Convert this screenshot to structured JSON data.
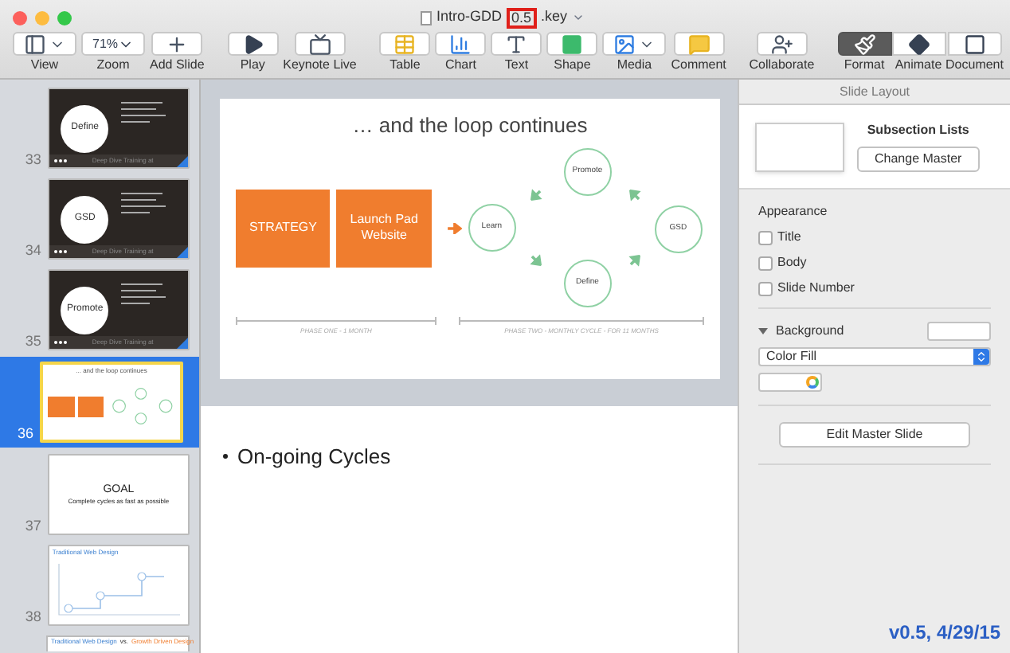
{
  "window": {
    "title": "Intro-GDD",
    "title_highlight": "0.5",
    "title_suffix": ".key"
  },
  "toolbar": [
    {
      "kind": "view",
      "label": "View"
    },
    {
      "kind": "zoom",
      "label": "Zoom",
      "value": "71%"
    },
    {
      "kind": "add",
      "label": "Add Slide"
    },
    {
      "kind": "gap"
    },
    {
      "kind": "play",
      "label": "Play"
    },
    {
      "kind": "live",
      "label": "Keynote Live"
    },
    {
      "kind": "gap"
    },
    {
      "kind": "table",
      "label": "Table"
    },
    {
      "kind": "chart",
      "label": "Chart"
    },
    {
      "kind": "text",
      "label": "Text"
    },
    {
      "kind": "shape",
      "label": "Shape"
    },
    {
      "kind": "media",
      "label": "Media"
    },
    {
      "kind": "comment",
      "label": "Comment"
    },
    {
      "kind": "gap"
    },
    {
      "kind": "collaborate",
      "label": "Collaborate"
    },
    {
      "kind": "gap"
    }
  ],
  "inspector_tabs": [
    {
      "kind": "format",
      "label": "Format",
      "selected": true
    },
    {
      "kind": "animate",
      "label": "Animate",
      "selected": false
    },
    {
      "kind": "document",
      "label": "Document",
      "selected": false
    }
  ],
  "slides": [
    {
      "kind": "photo",
      "number": "33",
      "circle": "Define",
      "footer": "Deep Dive Training at",
      "selected": false
    },
    {
      "kind": "photo",
      "number": "34",
      "circle": "GSD",
      "footer": "Deep Dive Training at",
      "selected": false
    },
    {
      "kind": "photo",
      "number": "35",
      "circle": "Promote",
      "footer": "Deep Dive Training at",
      "selected": false
    },
    {
      "kind": "loop",
      "number": "36",
      "title": "... and the loop continues",
      "selected": true
    },
    {
      "kind": "goal",
      "number": "37",
      "heading": "GOAL",
      "subtitle": "Complete cycles as fast as possible",
      "selected": false
    },
    {
      "kind": "chart",
      "number": "38",
      "title": "Traditional Web Design",
      "selected": false
    },
    {
      "kind": "partial",
      "title": "Traditional Web Design",
      "vs": "vs.",
      "title2": "Growth Driven Design",
      "selected": false
    }
  ],
  "slide": {
    "title": "… and the loop continues",
    "boxes": [
      "STRATEGY",
      "Launch Pad Website"
    ],
    "nodes": {
      "top": "Promote",
      "left": "Learn",
      "right": "GSD",
      "bottom": "Define"
    },
    "phases": [
      "PHASE ONE - 1 MONTH",
      "PHASE TWO - MONTHLY CYCLE - FOR 11 MONTHS"
    ]
  },
  "notes": {
    "bullets": [
      "On-going Cycles"
    ]
  },
  "inspector": {
    "tab": "Slide Layout",
    "master_name": "Subsection Lists",
    "change_master": "Change Master",
    "appearance": "Appearance",
    "checks": [
      {
        "label": "Title",
        "checked": false
      },
      {
        "label": "Body",
        "checked": false
      },
      {
        "label": "Slide Number",
        "checked": false
      }
    ],
    "background": {
      "heading": "Background",
      "expanded": true,
      "fill": "Color Fill"
    },
    "edit_master": "Edit Master Slide"
  },
  "annotation": "v0.5, 4/29/15"
}
